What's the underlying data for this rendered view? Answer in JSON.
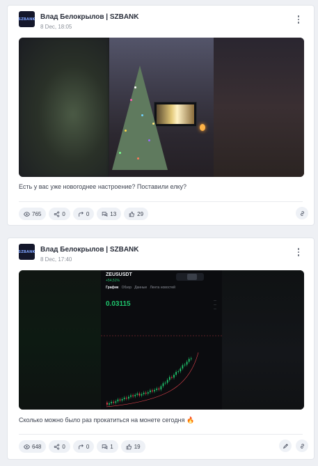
{
  "posts": [
    {
      "avatar_text": "SZBANK",
      "author": "Влад Белокрылов | SZBANK",
      "date": "8 Dec, 18:05",
      "caption": "Есть у вас уже новогоднее настроение? Поставили елку?",
      "stats": {
        "views": "765",
        "reposts": "0",
        "shares": "0",
        "comments": "13",
        "likes": "29"
      }
    },
    {
      "avatar_text": "SZBANK",
      "author": "Влад Белокрылов | SZBANK",
      "date": "8 Dec, 17:40",
      "caption": "Сколько можно было раз прокатиться на монете сегодня 🔥",
      "stats": {
        "views": "648",
        "reposts": "0",
        "shares": "0",
        "comments": "1",
        "likes": "19"
      },
      "chart_image": {
        "ticker": "ZEUSUSDT",
        "change": "+54,51%",
        "tabs": [
          "График",
          "Обзор",
          "Данные",
          "Лента новостей"
        ],
        "price": "0.03115"
      }
    }
  ],
  "icons": {
    "views": "eye-icon",
    "reposts": "share-nodes-icon",
    "shares": "forward-arrow-icon",
    "comments": "comments-icon",
    "likes": "thumbs-up-icon",
    "copy_link": "link-icon",
    "edit": "pencil-icon",
    "menu": "more-vertical-icon"
  },
  "colors": {
    "accent_up": "#1fc46c",
    "accent_down": "#e0434d",
    "pill_bg": "#eef1f6"
  }
}
